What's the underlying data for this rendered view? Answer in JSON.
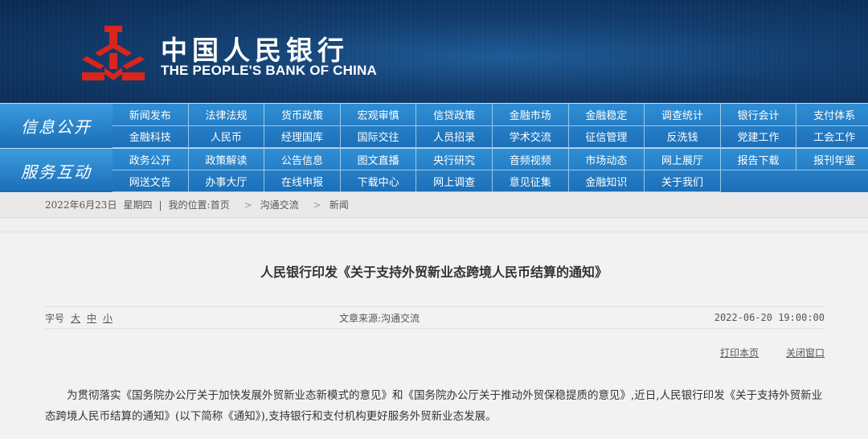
{
  "header": {
    "bank_name_cn": "中国人民银行",
    "bank_name_en": "THE PEOPLE'S BANK OF CHINA",
    "logo_icon": "pboc-logo-icon",
    "logo_color": "#d9251c"
  },
  "nav": {
    "group1_label": "信息公开",
    "group1_items": [
      "新闻发布",
      "法律法规",
      "货币政策",
      "宏观审慎",
      "信贷政策",
      "金融市场",
      "金融稳定",
      "调查统计",
      "银行会计",
      "支付体系",
      "金融科技",
      "人民币",
      "经理国库",
      "国际交往",
      "人员招录",
      "学术交流",
      "征信管理",
      "反洗钱",
      "党建工作",
      "工会工作"
    ],
    "group2_label": "服务互动",
    "group2_items": [
      "政务公开",
      "政策解读",
      "公告信息",
      "图文直播",
      "央行研究",
      "音频视频",
      "市场动态",
      "网上展厅",
      "报告下载",
      "报刊年鉴",
      "网送文告",
      "办事大厅",
      "在线申报",
      "下载中心",
      "网上调查",
      "意见征集",
      "金融知识",
      "关于我们"
    ]
  },
  "breadcrumb": {
    "date": "2022年6月23日",
    "weekday": "星期四",
    "location_label": "我的位置:",
    "home": "首页",
    "level1": "沟通交流",
    "level2": "新闻",
    "sep": ">"
  },
  "article": {
    "title": "人民银行印发《关于支持外贸新业态跨境人民币结算的通知》",
    "font_size_label": "字号",
    "font_large": "大",
    "font_medium": "中",
    "font_small": "小",
    "source": "文章来源:沟通交流",
    "date": "2022-06-20 19:00:00",
    "print_label": "打印本页",
    "close_label": "关闭窗口",
    "body": "为贯彻落实《国务院办公厅关于加快发展外贸新业态新模式的意见》和《国务院办公厅关于推动外贸保稳提质的意见》,近日,人民银行印发《关于支持外贸新业态跨境人民币结算的通知》(以下简称《通知》),支持银行和支付机构更好服务外贸新业态发展。"
  }
}
